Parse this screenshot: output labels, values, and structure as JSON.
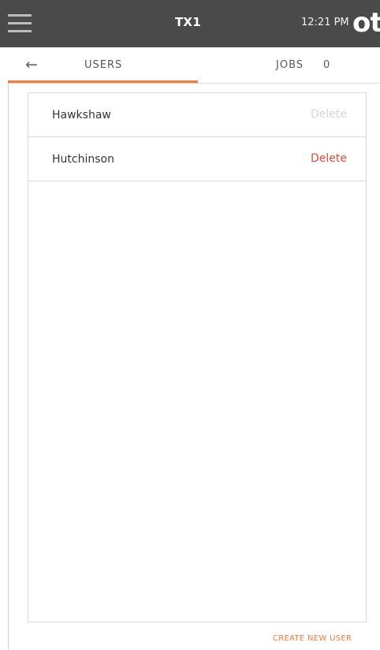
{
  "header": {
    "menu_icon": "hamburger-icon",
    "title": "TX1",
    "time": "12:21 PM",
    "logo_text": "ot"
  },
  "tabs": {
    "back_icon": "back-arrow-icon",
    "back_glyph": "←",
    "users_label": "USERS",
    "jobs_label": "JOBS",
    "jobs_count": "0",
    "active_color": "#f47a3c"
  },
  "users": [
    {
      "name": "Hawkshaw",
      "delete_label": "Delete",
      "delete_enabled": false
    },
    {
      "name": "Hutchinson",
      "delete_label": "Delete",
      "delete_enabled": true
    }
  ],
  "footer": {
    "create_user_label": "CREATE NEW USER"
  },
  "colors": {
    "header_bg": "#4a4a4a",
    "accent": "#f47a3c",
    "delete_active": "#e84a3a",
    "delete_disabled": "#d6d6d6"
  }
}
